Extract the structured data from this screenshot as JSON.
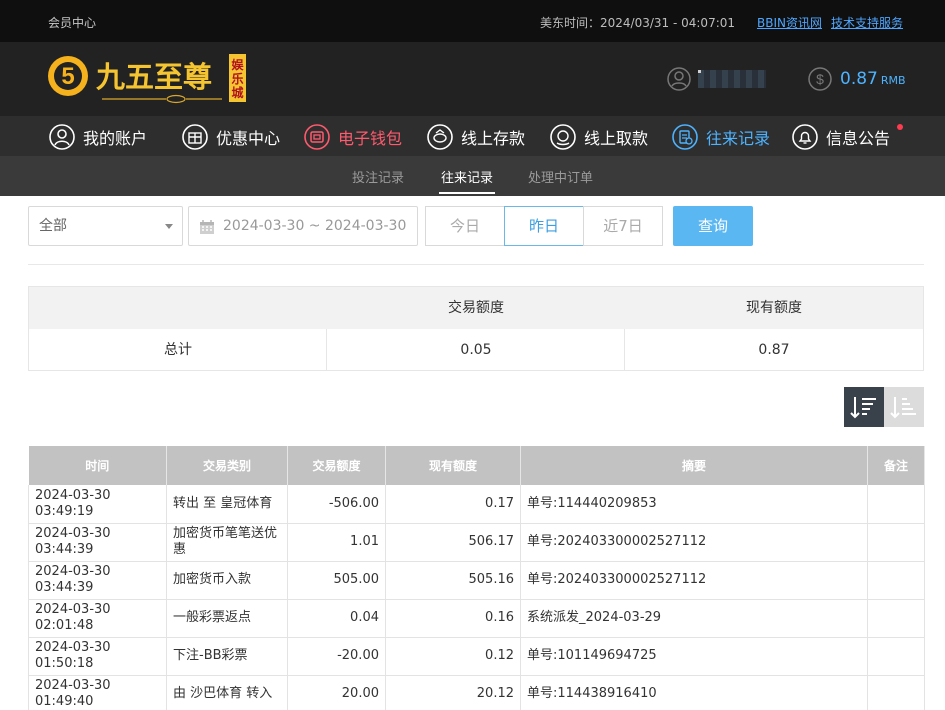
{
  "topbar": {
    "member_center": "会员中心",
    "time": "美东时间：2024/03/31 - 04:07:01",
    "bbin_link": "BBIN资讯网",
    "support_link": "技术支持服务"
  },
  "header": {
    "brand": "九五至尊",
    "brand_tag": "娱乐城",
    "balance": "0.87",
    "balance_unit": "RMB"
  },
  "nav": {
    "items": [
      {
        "label": "我的账户",
        "icon": "user-circle-icon"
      },
      {
        "label": "优惠中心",
        "icon": "gift-icon"
      },
      {
        "label": "电子钱包",
        "icon": "wallet-icon"
      },
      {
        "label": "线上存款",
        "icon": "deposit-icon"
      },
      {
        "label": "线上取款",
        "icon": "withdraw-icon"
      },
      {
        "label": "往来记录",
        "icon": "records-icon"
      },
      {
        "label": "信息公告",
        "icon": "bell-icon"
      }
    ]
  },
  "subnav": {
    "tabs": [
      "投注记录",
      "往来记录",
      "处理中订单"
    ]
  },
  "filter": {
    "type_selected": "全部",
    "date_range": "2024-03-30 ~ 2024-03-30",
    "quick": [
      "今日",
      "昨日",
      "近7日"
    ],
    "query_label": "查询"
  },
  "summary": {
    "col_amount": "交易额度",
    "col_balance": "现有额度",
    "total_label": "总计",
    "total_amount": "0.05",
    "total_balance": "0.87"
  },
  "colors": {
    "accent_blue": "#4db3ff",
    "wallet_red": "#ff5a6e",
    "query_button": "#5ab7f2"
  },
  "records": {
    "headers": [
      "时间",
      "交易类别",
      "交易额度",
      "现有额度",
      "摘要",
      "备注"
    ],
    "rows": [
      [
        "2024-03-30 03:49:19",
        "转出 至 皇冠体育",
        "-506.00",
        "0.17",
        "单号:114440209853",
        ""
      ],
      [
        "2024-03-30 03:44:39",
        "加密货币笔笔送优惠",
        "1.01",
        "506.17",
        "单号:202403300002527112",
        ""
      ],
      [
        "2024-03-30 03:44:39",
        "加密货币入款",
        "505.00",
        "505.16",
        "单号:202403300002527112",
        ""
      ],
      [
        "2024-03-30 02:01:48",
        "一般彩票返点",
        "0.04",
        "0.16",
        "系统派发_2024-03-29",
        ""
      ],
      [
        "2024-03-30 01:50:18",
        "下注-BB彩票",
        "-20.00",
        "0.12",
        "单号:101149694725",
        ""
      ],
      [
        "2024-03-30 01:49:40",
        "由 沙巴体育 转入",
        "20.00",
        "20.12",
        "单号:114438916410",
        ""
      ]
    ]
  }
}
